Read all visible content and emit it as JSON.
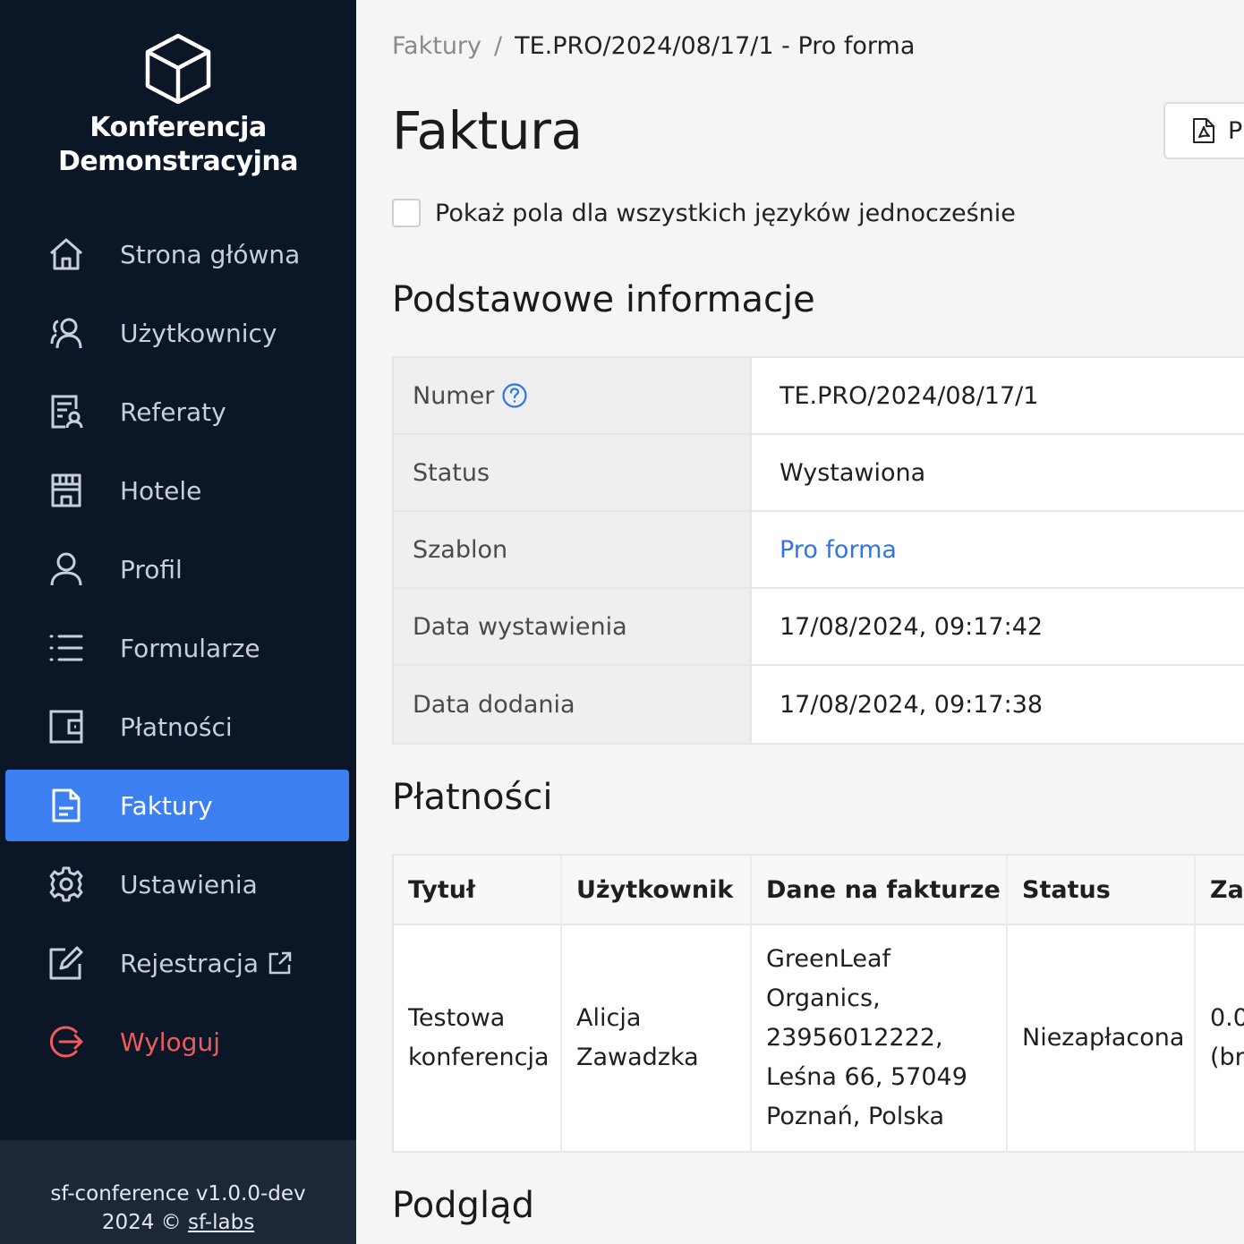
{
  "brand": {
    "name_line1": "Konferencja",
    "name_line2": "Demonstracyjna"
  },
  "nav": {
    "items": [
      {
        "label": "Strona główna",
        "icon": "home-icon"
      },
      {
        "label": "Użytkownicy",
        "icon": "users-icon"
      },
      {
        "label": "Referaty",
        "icon": "papers-icon"
      },
      {
        "label": "Hotele",
        "icon": "hotel-icon"
      },
      {
        "label": "Profil",
        "icon": "profile-icon"
      },
      {
        "label": "Formularze",
        "icon": "list-icon"
      },
      {
        "label": "Płatności",
        "icon": "wallet-icon"
      },
      {
        "label": "Faktury",
        "icon": "document-icon",
        "active": true
      },
      {
        "label": "Ustawienia",
        "icon": "gear-icon"
      },
      {
        "label": "Rejestracja",
        "icon": "edit-icon",
        "external": true
      },
      {
        "label": "Wyloguj",
        "icon": "logout-icon"
      }
    ]
  },
  "footer": {
    "version": "sf-conference v1.0.0-dev",
    "copyright": "2024 ©",
    "link": "sf-labs"
  },
  "breadcrumb": {
    "parent": "Faktury",
    "separator": "/",
    "current": "TE.PRO/2024/08/17/1 - Pro forma"
  },
  "page": {
    "title": "Faktura",
    "pdf_label": "P"
  },
  "lang_toggle": {
    "label": "Pokaż pola dla wszystkich języków jednocześnie"
  },
  "basic_info": {
    "title": "Podstawowe informacje",
    "rows": [
      {
        "label": "Numer",
        "value": "TE.PRO/2024/08/17/1"
      },
      {
        "label": "Status",
        "value": "Wystawiona"
      },
      {
        "label": "Szablon",
        "value": "Pro forma"
      },
      {
        "label": "Data wystawienia",
        "value": "17/08/2024, 09:17:42"
      },
      {
        "label": "Data dodania",
        "value": "17/08/2024, 09:17:38"
      }
    ]
  },
  "payments": {
    "title": "Płatności",
    "columns": [
      "Tytuł",
      "Użytkownik",
      "Dane na fakturze",
      "Status",
      "Zap"
    ],
    "row": {
      "title_l1": "Testowa",
      "title_l2": "konferencja",
      "user_l1": "Alicja",
      "user_l2": "Zawadzka",
      "invoice_l1": "GreenLeaf",
      "invoice_l2": "Organics,",
      "invoice_l3": "23956012222,",
      "invoice_l4": "Leśna 66, 57049",
      "invoice_l5": "Poznań, Polska",
      "status": "Niezapłacona",
      "amount_l1": "0.0",
      "amount_l2": "(br"
    }
  },
  "preview": {
    "title": "Podgląd"
  },
  "colors": {
    "sidebar": "#0b1727",
    "active": "#3b7ff0",
    "link": "#2f76e0",
    "logout": "#ef5a5a"
  }
}
